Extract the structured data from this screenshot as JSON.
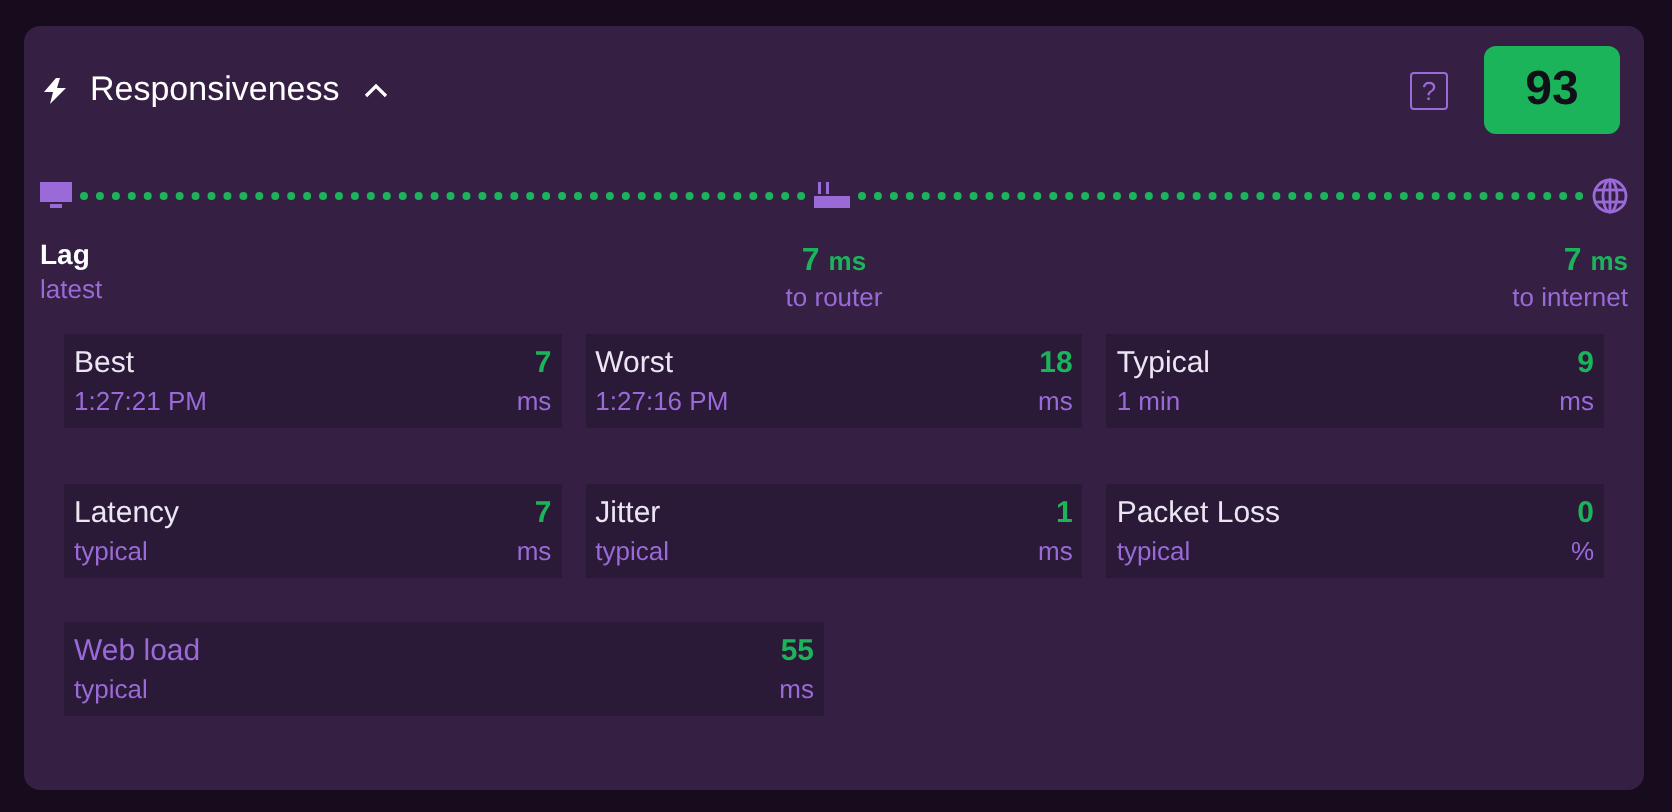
{
  "header": {
    "title": "Responsiveness",
    "expanded": true,
    "help": "?",
    "score": "93"
  },
  "path": {
    "lag": {
      "label": "Lag",
      "sub": "latest"
    },
    "router": {
      "value": "7",
      "unit": "ms",
      "label": "to router"
    },
    "internet": {
      "value": "7",
      "unit": "ms",
      "label": "to internet"
    }
  },
  "stat_groups": [
    [
      {
        "title": "Best",
        "sub": "1:27:21 PM",
        "value": "7",
        "unit": "ms",
        "muted": false
      },
      {
        "title": "Worst",
        "sub": "1:27:16 PM",
        "value": "18",
        "unit": "ms",
        "muted": false
      },
      {
        "title": "Typical",
        "sub": "1 min",
        "value": "9",
        "unit": "ms",
        "muted": false
      }
    ],
    [
      {
        "title": "Latency",
        "sub": "typical",
        "value": "7",
        "unit": "ms",
        "muted": false
      },
      {
        "title": "Jitter",
        "sub": "typical",
        "value": "1",
        "unit": "ms",
        "muted": false
      },
      {
        "title": "Packet Loss",
        "sub": "typical",
        "value": "0",
        "unit": "%",
        "muted": false
      }
    ],
    [
      {
        "title": "Web load",
        "sub": "typical",
        "value": "55",
        "unit": "ms",
        "muted": true
      }
    ]
  ]
}
